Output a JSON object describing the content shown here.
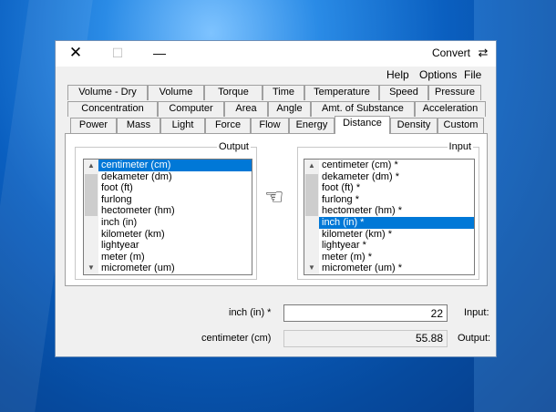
{
  "window": {
    "title": "Convert",
    "close_glyph": "✕",
    "max_glyph": "☐",
    "min_glyph": "—",
    "icon_name": "convert-arrows-icon",
    "icon_glyph": "⇄"
  },
  "menu": [
    "File",
    "Options",
    "Help"
  ],
  "tabs": {
    "row1": [
      "Pressure",
      "Speed",
      "Temperature",
      "Time",
      "Torque",
      "Volume",
      "Volume - Dry"
    ],
    "row2": [
      "Acceleration",
      "Amt. of Substance",
      "Angle",
      "Area",
      "Computer",
      "Concentration"
    ],
    "row3": [
      "Custom",
      "Density",
      "Distance",
      "Energy",
      "Flow",
      "Force",
      "Light",
      "Mass",
      "Power"
    ],
    "active": "Distance"
  },
  "input_group": {
    "label": "Input",
    "items": [
      "centimeter (cm) *",
      "dekameter (dm) *",
      "foot (ft) *",
      "furlong *",
      "hectometer (hm) *",
      "inch (in) *",
      "kilometer (km) *",
      "lightyear *",
      "meter (m) *",
      "micrometer (um) *"
    ],
    "selected": 5
  },
  "output_group": {
    "label": "Output",
    "items": [
      "centimeter (cm)",
      "dekameter (dm)",
      "foot (ft)",
      "furlong",
      "hectometer (hm)",
      "inch (in)",
      "kilometer (km)",
      "lightyear",
      "meter (m)",
      "micrometer (um)"
    ],
    "selected": 0
  },
  "pointer": {
    "icon_name": "pointing-hand-icon",
    "glyph": "☜"
  },
  "scroll": {
    "up": "▲",
    "down": "▼"
  },
  "input_row": {
    "label": "Input:",
    "value": "22",
    "unit": "inch (in) *"
  },
  "output_row": {
    "label": "Output:",
    "value": "55.88",
    "unit": "centimeter (cm)"
  }
}
